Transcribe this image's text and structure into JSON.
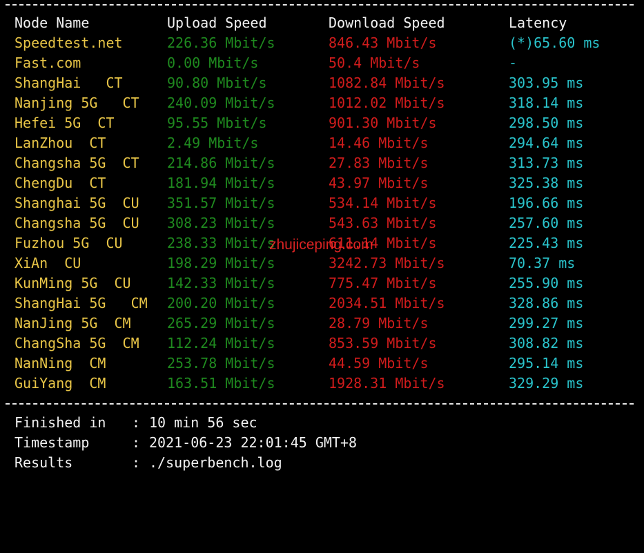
{
  "header": {
    "node_name": "Node Name",
    "upload_speed": "Upload Speed",
    "download_speed": "Download Speed",
    "latency": "Latency"
  },
  "rows": [
    {
      "node": "Speedtest.net",
      "upload": "226.36 Mbit/s",
      "download": "846.43 Mbit/s",
      "latency": "(*)65.60 ms"
    },
    {
      "node": "Fast.com",
      "upload": "0.00 Mbit/s",
      "download": "50.4 Mbit/s",
      "latency": "-"
    },
    {
      "node": "ShangHai   CT",
      "upload": "90.80 Mbit/s",
      "download": "1082.84 Mbit/s",
      "latency": "303.95 ms"
    },
    {
      "node": "Nanjing 5G   CT",
      "upload": "240.09 Mbit/s",
      "download": "1012.02 Mbit/s",
      "latency": "318.14 ms"
    },
    {
      "node": "Hefei 5G  CT",
      "upload": "95.55 Mbit/s",
      "download": "901.30 Mbit/s",
      "latency": "298.50 ms"
    },
    {
      "node": "LanZhou  CT",
      "upload": "2.49 Mbit/s",
      "download": "14.46 Mbit/s",
      "latency": "294.64 ms"
    },
    {
      "node": "Changsha 5G  CT",
      "upload": "214.86 Mbit/s",
      "download": "27.83 Mbit/s",
      "latency": "313.73 ms"
    },
    {
      "node": "ChengDu  CT",
      "upload": "181.94 Mbit/s",
      "download": "43.97 Mbit/s",
      "latency": "325.38 ms"
    },
    {
      "node": "Shanghai 5G  CU",
      "upload": "351.57 Mbit/s",
      "download": "534.14 Mbit/s",
      "latency": "196.66 ms"
    },
    {
      "node": "Changsha 5G  CU",
      "upload": "308.23 Mbit/s",
      "download": "543.63 Mbit/s",
      "latency": "257.60 ms"
    },
    {
      "node": "Fuzhou 5G  CU",
      "upload": "238.33 Mbit/s",
      "download": "611.14 Mbit/s",
      "latency": "225.43 ms"
    },
    {
      "node": "XiAn  CU",
      "upload": "198.29 Mbit/s",
      "download": "3242.73 Mbit/s",
      "latency": "70.37 ms"
    },
    {
      "node": "KunMing 5G  CU",
      "upload": "142.33 Mbit/s",
      "download": "775.47 Mbit/s",
      "latency": "255.90 ms"
    },
    {
      "node": "ShangHai 5G   CM",
      "upload": "200.20 Mbit/s",
      "download": "2034.51 Mbit/s",
      "latency": "328.86 ms"
    },
    {
      "node": "NanJing 5G  CM",
      "upload": "265.29 Mbit/s",
      "download": "28.79 Mbit/s",
      "latency": "299.27 ms"
    },
    {
      "node": "ChangSha 5G  CM",
      "upload": "112.24 Mbit/s",
      "download": "853.59 Mbit/s",
      "latency": "308.82 ms"
    },
    {
      "node": "NanNing  CM",
      "upload": "253.78 Mbit/s",
      "download": "44.59 Mbit/s",
      "latency": "295.14 ms"
    },
    {
      "node": "GuiYang  CM",
      "upload": "163.51 Mbit/s",
      "download": "1928.31 Mbit/s",
      "latency": "329.29 ms"
    }
  ],
  "footer": {
    "finished_label": "Finished in",
    "finished_value": "10 min 56 sec",
    "timestamp_label": "Timestamp",
    "timestamp_value": "2021-06-23 22:01:45 GMT+8",
    "results_label": "Results",
    "results_value": "./superbench.log",
    "separator": ":"
  },
  "watermark": "zhujiceping.com",
  "colors": {
    "background": "#000000",
    "node_name": "#e8c547",
    "upload": "#1f8a1f",
    "download": "#d01c1c",
    "latency": "#2ac4cc",
    "header_text": "#f2f2f2",
    "watermark": "#ff2a2a"
  }
}
